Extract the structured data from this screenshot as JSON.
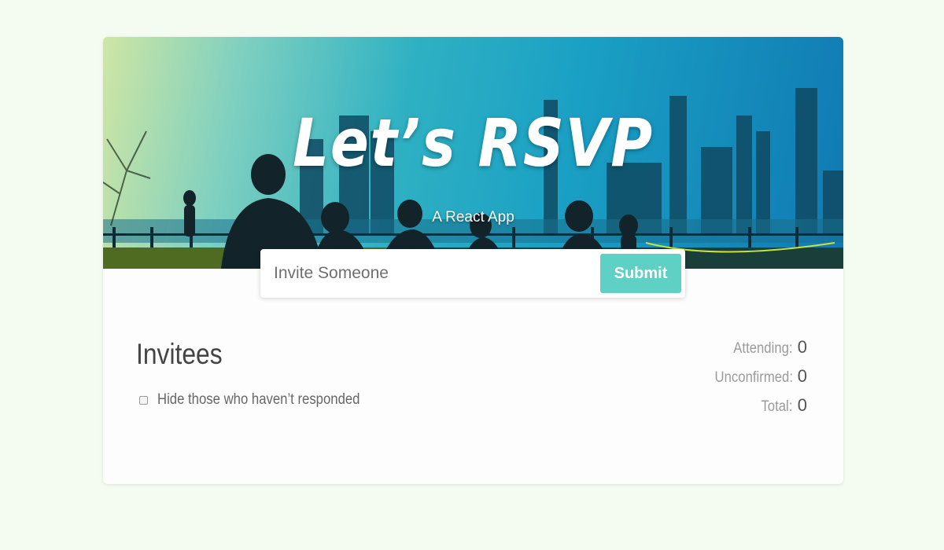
{
  "header": {
    "title": "Let’s RSVP",
    "subtitle": "A React App"
  },
  "invite_form": {
    "placeholder": "Invite Someone",
    "submit_label": "Submit"
  },
  "invitees": {
    "heading": "Invitees",
    "filter_label": "Hide those who haven’t responded",
    "filter_checked": false
  },
  "counter": {
    "attending_label": "Attending:",
    "attending_value": "0",
    "unconfirmed_label": "Unconfirmed:",
    "unconfirmed_value": "0",
    "total_label": "Total:",
    "total_value": "0"
  },
  "colors": {
    "page_background": "#f4fcf2",
    "accent": "#5fd0c4",
    "header_gradient_start": "#cfe6a4",
    "header_gradient_end": "#1079b3"
  }
}
